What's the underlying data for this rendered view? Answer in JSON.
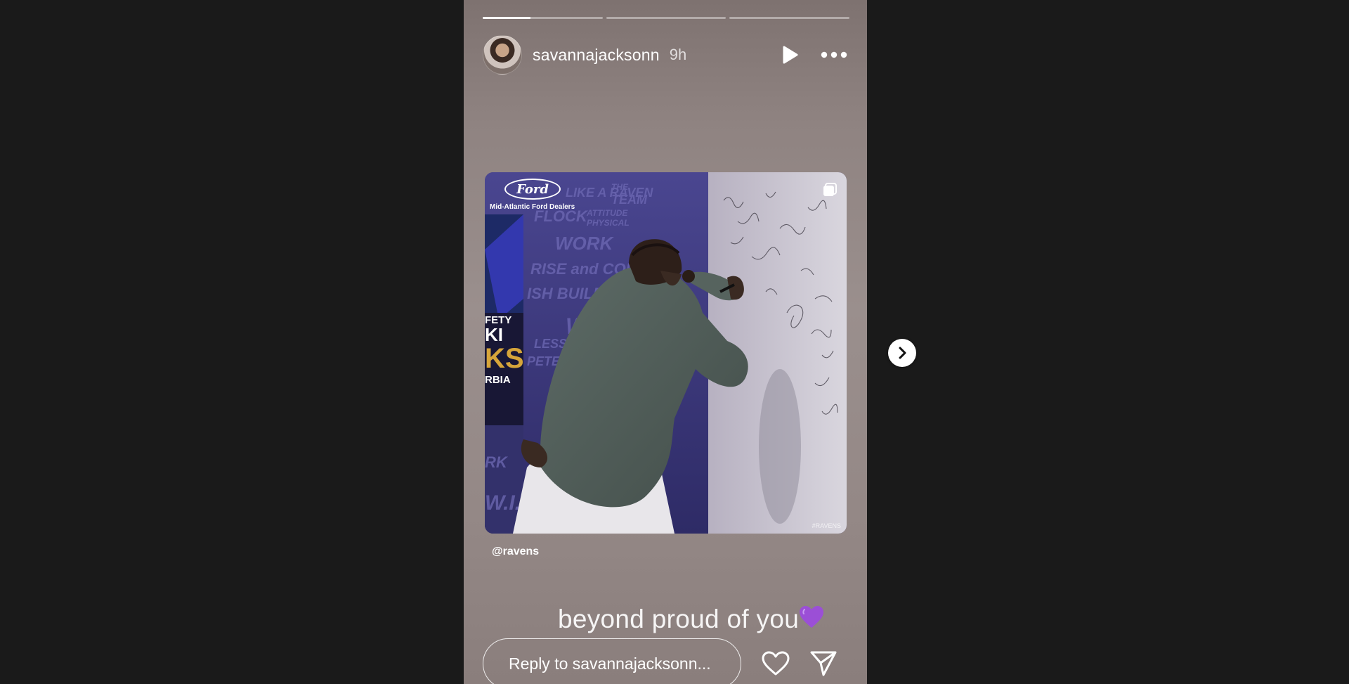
{
  "story": {
    "progress": {
      "segments": [
        0.4,
        0,
        0
      ],
      "active_color": "#ffffff",
      "inactive_color": "rgba(255,255,255,0.4)"
    },
    "header": {
      "username": "savannajacksonn",
      "time_ago": "9h",
      "play_icon": "play-icon",
      "more_icon": "more-horizontal-icon"
    },
    "media": {
      "brand_logo_text": "Ford",
      "dealer_label": "Mid-Atlantic Ford Dealers",
      "watermark": "#RAVENS",
      "multi_image_icon": "copy-icon"
    },
    "mention": "@ravens",
    "caption": "beyond proud of you",
    "caption_emoji": "purple-heart",
    "footer": {
      "reply_placeholder": "Reply to savannajacksonn...",
      "like_icon": "heart-outline-icon",
      "send_icon": "paper-plane-icon"
    }
  },
  "navigation": {
    "next_icon": "chevron-right-icon"
  },
  "colors": {
    "background": "#1a1a1a",
    "story_gradient_top": "#7e7270",
    "story_gradient_mid": "#9a8f8d",
    "emoji_purple": "#9b4fd6"
  }
}
